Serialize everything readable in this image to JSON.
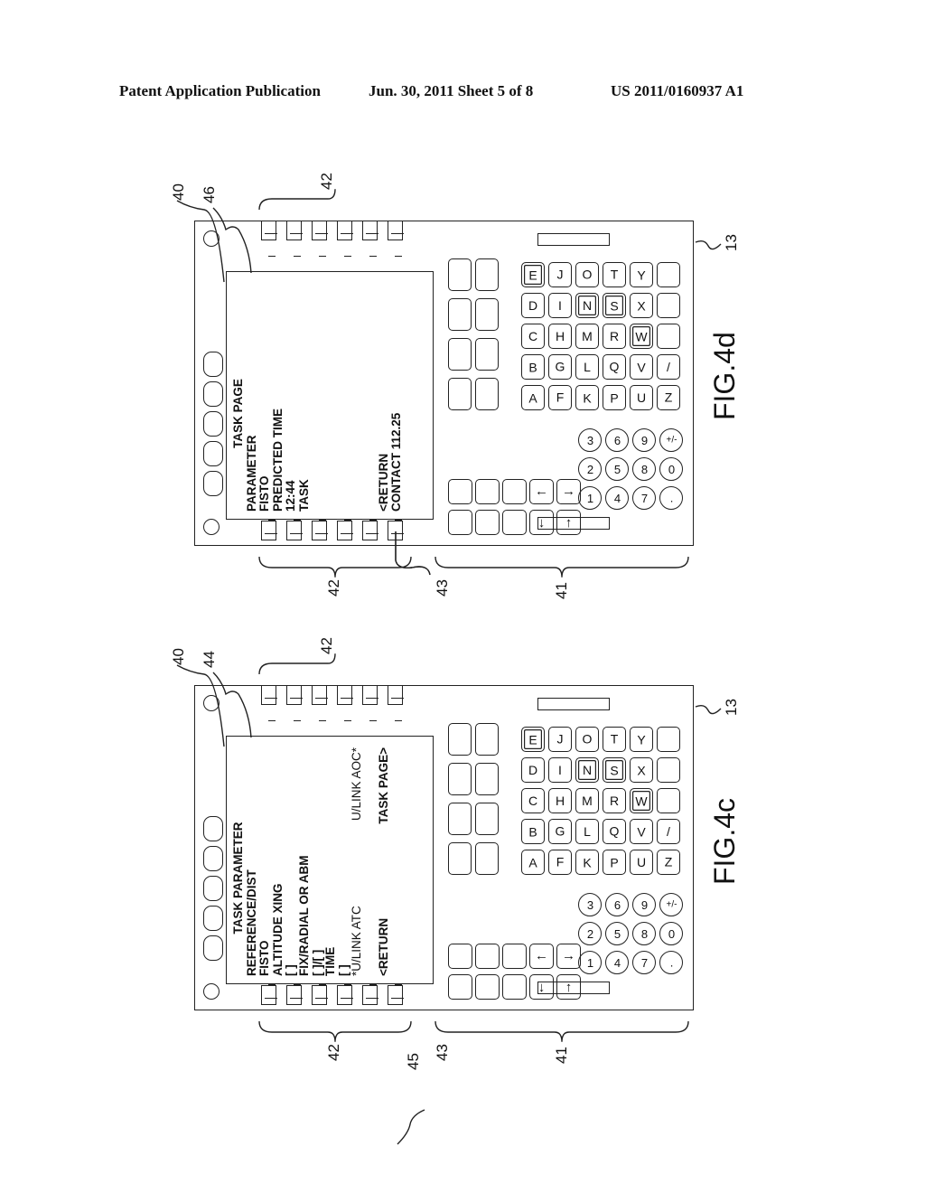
{
  "header": {
    "left": "Patent Application Publication",
    "center": "Jun. 30, 2011  Sheet 5 of 8",
    "right": "US 2011/0160937 A1"
  },
  "figures": [
    {
      "id": "fig4d",
      "label": "FIG.4d",
      "refs": {
        "device": "13",
        "display": "40",
        "page": "46",
        "lsk_left": "42",
        "lsk_right": "42",
        "lsk_return": "43",
        "keyboard": "41"
      },
      "screen_lines": [
        {
          "text": "TASK PAGE",
          "row": 0,
          "col": "center"
        },
        {
          "text": "PARAMETER",
          "row": 1
        },
        {
          "text": "FISTO",
          "row": 2
        },
        {
          "text": "PREDICTED TIME",
          "row": 3
        },
        {
          "text": "12:44",
          "row": 4
        },
        {
          "text": "TASK",
          "row": 5
        },
        {
          "text": "<RETURN",
          "row": 11
        },
        {
          "text": "CONTACT 112.25",
          "row": 12
        }
      ]
    },
    {
      "id": "fig4c",
      "label": "FIG.4c",
      "refs": {
        "device": "13",
        "display": "40",
        "page": "44",
        "lsk_left": "42",
        "lsk_right": "42",
        "lsk_return": "43",
        "lsk_taskpage": "45",
        "keyboard": "41"
      },
      "screen_lines": [
        {
          "text": "TASK PARAMETER",
          "row": 0,
          "col": "center"
        },
        {
          "text": "REFERENCE/DIST",
          "row": 1
        },
        {
          "text": "FISTO",
          "row": 2
        },
        {
          "text": "ALTITUDE XING",
          "row": 3
        },
        {
          "text": "[  ]",
          "row": 4
        },
        {
          "text": "FIX/RADIAL OR ABM",
          "row": 5
        },
        {
          "text": "[  ]/[  ]",
          "row": 6
        },
        {
          "text": "TIME",
          "row": 7
        },
        {
          "text": "[  ]",
          "row": 8
        },
        {
          "text": "*U/LINK ATC",
          "row": 9
        },
        {
          "text": "U/LINK AOC*",
          "row": 9,
          "col": "right"
        },
        {
          "text": "<RETURN",
          "row": 11
        },
        {
          "text": "TASK PAGE>",
          "row": 11,
          "col": "right"
        }
      ]
    }
  ],
  "keyboard": {
    "alpha_rows": [
      [
        "A",
        "F",
        "K",
        "P",
        "U",
        "Z"
      ],
      [
        "B",
        "G",
        "L",
        "Q",
        "V",
        "/"
      ],
      [
        "C",
        "H",
        "M",
        "R",
        "W",
        ""
      ],
      [
        "D",
        "I",
        "N",
        "S",
        "X",
        ""
      ],
      [
        "E",
        "J",
        "O",
        "T",
        "Y",
        ""
      ]
    ],
    "highlighted": [
      "E",
      "N",
      "S",
      "W"
    ],
    "numeric_rows": [
      [
        "1",
        "4",
        "7",
        "."
      ],
      [
        "2",
        "5",
        "8",
        "0"
      ],
      [
        "3",
        "6",
        "9",
        "+/-"
      ]
    ],
    "arrows": {
      "row1": [
        "↓",
        "↑"
      ],
      "row2": [
        "←",
        "→"
      ]
    }
  }
}
